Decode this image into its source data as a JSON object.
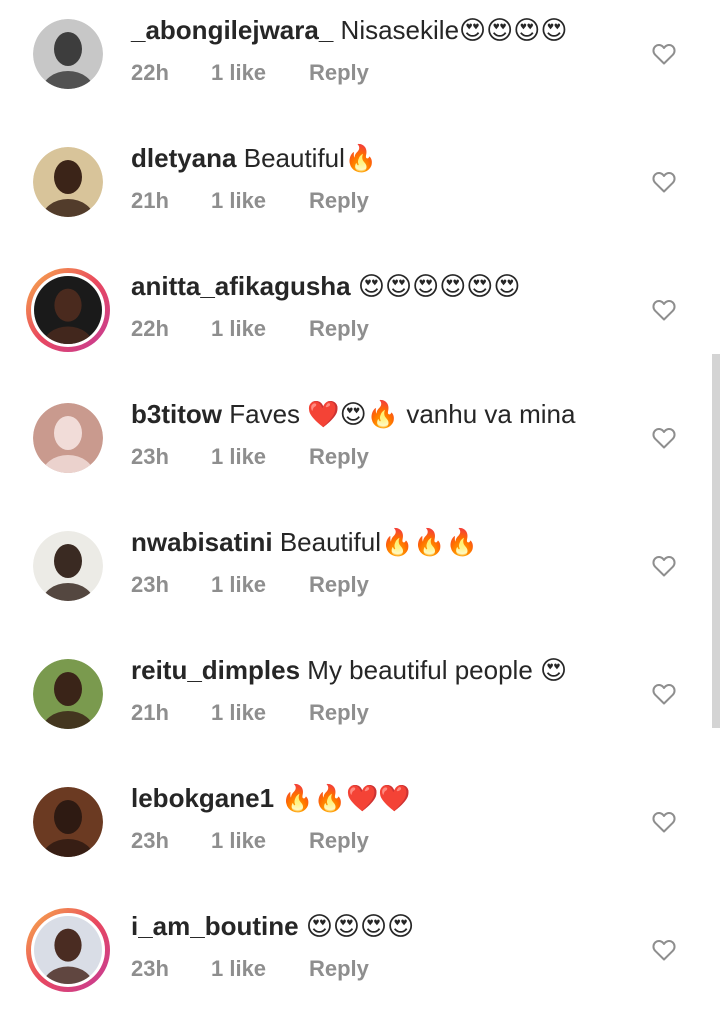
{
  "comments": [
    {
      "username": "_abongilejwara_",
      "text": "Nisasekile😍😍😍😍",
      "time": "22h",
      "likes": "1 like",
      "reply": "Reply",
      "avatar": {
        "bg": "#c7c7c7",
        "skin": "#3d3d3d",
        "story_ring": false
      }
    },
    {
      "username": "dletyana",
      "text": "Beautiful🔥",
      "time": "21h",
      "likes": "1 like",
      "reply": "Reply",
      "avatar": {
        "bg": "#d8c49a",
        "skin": "#3b2418",
        "story_ring": false
      }
    },
    {
      "username": "anitta_afikagusha",
      "text": "😍😍😍😍😍😍",
      "time": "22h",
      "likes": "1 like",
      "reply": "Reply",
      "avatar": {
        "bg": "#1a1a1a",
        "skin": "#4a2a1e",
        "story_ring": true
      }
    },
    {
      "username": "b3titow",
      "text": "Faves ❤️😍🔥 vanhu va mina",
      "time": "23h",
      "likes": "1 like",
      "reply": "Reply",
      "avatar": {
        "bg": "#c99a8e",
        "skin": "#f1dcd8",
        "story_ring": false
      }
    },
    {
      "username": "nwabisatini",
      "text": "Beautiful🔥🔥🔥",
      "time": "23h",
      "likes": "1 like",
      "reply": "Reply",
      "avatar": {
        "bg": "#ecebe6",
        "skin": "#3a2a22",
        "story_ring": false
      }
    },
    {
      "username": "reitu_dimples",
      "text": "My beautiful people 😍",
      "time": "21h",
      "likes": "1 like",
      "reply": "Reply",
      "avatar": {
        "bg": "#7a9a4e",
        "skin": "#3a2418",
        "story_ring": false
      }
    },
    {
      "username": "lebokgane1",
      "text": "🔥🔥❤️❤️",
      "time": "23h",
      "likes": "1 like",
      "reply": "Reply",
      "avatar": {
        "bg": "#6b3a22",
        "skin": "#2e1a12",
        "story_ring": false
      }
    },
    {
      "username": "i_am_boutine",
      "text": "😍😍😍😍",
      "time": "23h",
      "likes": "1 like",
      "reply": "Reply",
      "avatar": {
        "bg": "#d9dde6",
        "skin": "#4a2c22",
        "story_ring": true
      }
    }
  ],
  "icons": {
    "like": "heart-outline-icon"
  },
  "colors": {
    "username": "#262626",
    "meta": "#8e8e8e",
    "heart": "#8e8e8e",
    "scrollbar": "#d4d4d4"
  }
}
